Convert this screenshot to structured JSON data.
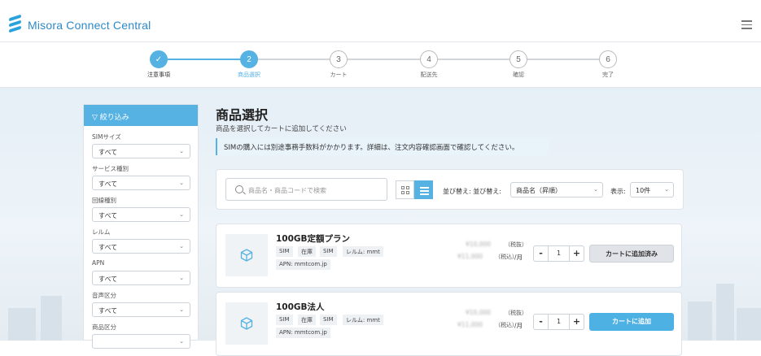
{
  "header": {
    "app_title": "Misora Connect Central"
  },
  "steps": [
    {
      "number": "✓",
      "label": "注意事項"
    },
    {
      "number": "2",
      "label": "商品選択"
    },
    {
      "number": "3",
      "label": "カート"
    },
    {
      "number": "4",
      "label": "配送先"
    },
    {
      "number": "5",
      "label": "確認"
    },
    {
      "number": "6",
      "label": "完了"
    }
  ],
  "sidebar": {
    "title": "絞り込み",
    "filters": [
      {
        "label": "SIMサイズ",
        "value": "すべて"
      },
      {
        "label": "サービス種別",
        "value": "すべて"
      },
      {
        "label": "回線種別",
        "value": "すべて"
      },
      {
        "label": "レルム",
        "value": "すべて"
      },
      {
        "label": "APN",
        "value": "すべて"
      },
      {
        "label": "音声区分",
        "value": "すべて"
      },
      {
        "label": "商品区分",
        "value": ""
      }
    ]
  },
  "main": {
    "title": "商品選択",
    "subtitle": "商品を選択してカートに追加してください",
    "notice": "SIMの購入には別途事務手数料がかかります。詳細は、注文内容確認画面で確認してください。"
  },
  "search": {
    "placeholder": "商品名・商品コードで検索",
    "sort_label": "並び替え: 並び替え:",
    "sort_value": "商品名（昇順）",
    "display_label": "表示:",
    "display_value": "10件"
  },
  "products": [
    {
      "name": "100GB定額プラン",
      "tags": [
        "SIM",
        "在庫",
        "SIM",
        "レルム: mmt"
      ],
      "apn": "APN: mmtcom.jp",
      "price_excl": "¥10,000",
      "tax_excl": "（税抜）",
      "price_incl": "¥11,000",
      "tax_incl": "（税込）",
      "per": "/月",
      "qty": "1",
      "button": "カートに追加済み",
      "added": true
    },
    {
      "name": "100GB法人",
      "tags": [
        "SIM",
        "在庫",
        "SIM",
        "レルム: mmt"
      ],
      "apn": "APN: mmtcom.jp",
      "price_excl": "¥10,000",
      "tax_excl": "（税抜）",
      "price_incl": "¥11,000",
      "tax_incl": "（税込）",
      "per": "/月",
      "qty": "1",
      "button": "カートに追加",
      "added": false
    }
  ],
  "colors": {
    "accent": "#56b2e2",
    "brand_text": "#2d8ac7"
  }
}
